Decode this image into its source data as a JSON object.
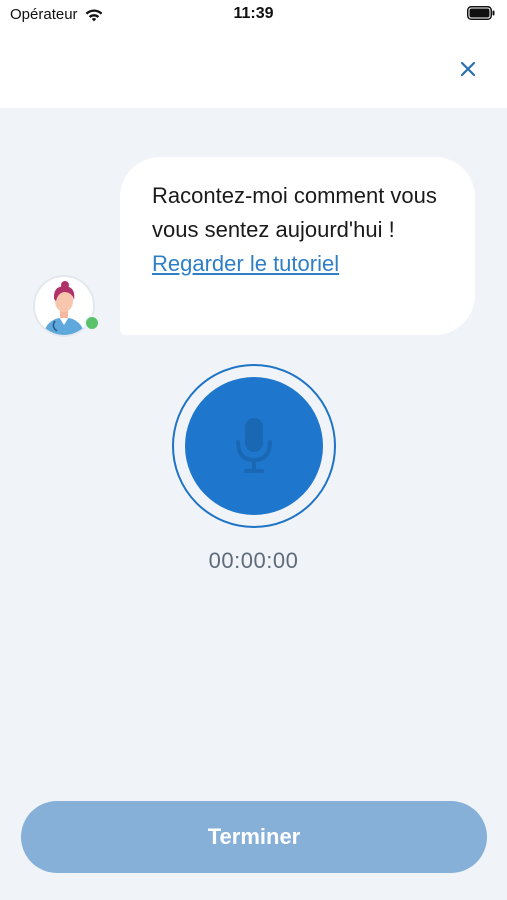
{
  "status_bar": {
    "carrier": "Opérateur",
    "time": "11:39"
  },
  "header": {
    "close_icon": "close-icon"
  },
  "chat": {
    "message_text": "Racontez-moi comment vous vous sentez aujourd'hui ! ",
    "link_text": "Regarder le tutoriel",
    "avatar_icon": "doctor-avatar-icon"
  },
  "recorder": {
    "mic_icon": "microphone-icon",
    "timer": "00:00:00"
  },
  "footer": {
    "finish_label": "Terminer"
  },
  "colors": {
    "background": "#f0f4f8",
    "accent": "#1e77cc",
    "link": "#2f7fc7",
    "button_disabled": "#86b0d8"
  }
}
